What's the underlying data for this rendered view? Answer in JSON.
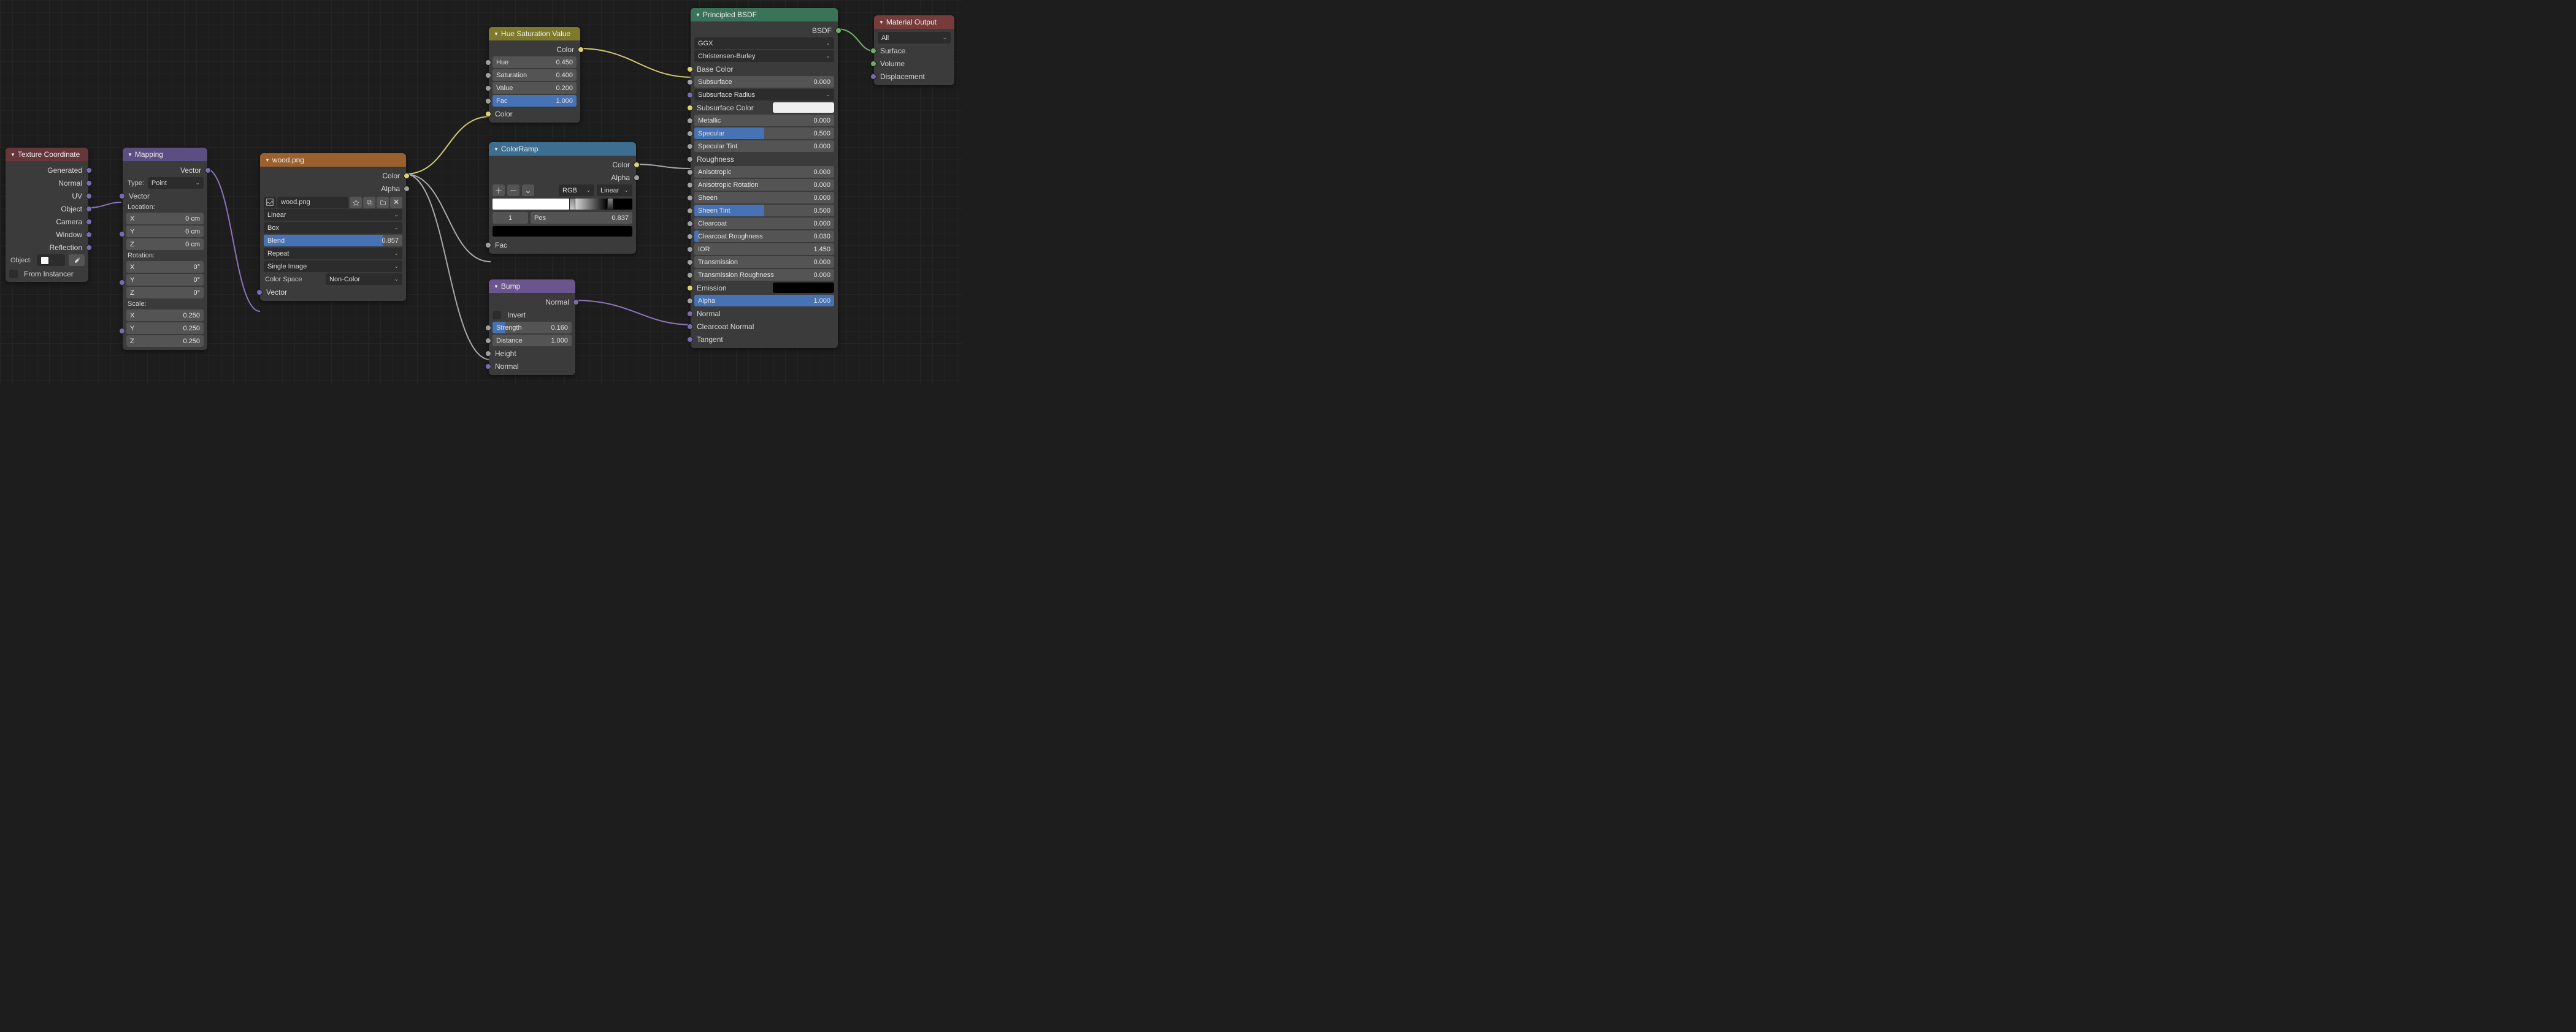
{
  "nodes": {
    "texcoord": {
      "title": "Texture Coordinate",
      "outputs": [
        "Generated",
        "Normal",
        "UV",
        "Object",
        "Camera",
        "Window",
        "Reflection"
      ],
      "object_label": "Object:",
      "from_instancer": "From Instancer"
    },
    "mapping": {
      "title": "Mapping",
      "out_vector": "Vector",
      "type_label": "Type:",
      "type_value": "Point",
      "in_vector": "Vector",
      "location_label": "Location:",
      "loc_x": {
        "k": "X",
        "v": "0 cm"
      },
      "loc_y": {
        "k": "Y",
        "v": "0 cm"
      },
      "loc_z": {
        "k": "Z",
        "v": "0 cm"
      },
      "rotation_label": "Rotation:",
      "rot_x": {
        "k": "X",
        "v": "0°"
      },
      "rot_y": {
        "k": "Y",
        "v": "0°"
      },
      "rot_z": {
        "k": "Z",
        "v": "0°"
      },
      "scale_label": "Scale:",
      "scl_x": {
        "k": "X",
        "v": "0.250"
      },
      "scl_y": {
        "k": "Y",
        "v": "0.250"
      },
      "scl_z": {
        "k": "Z",
        "v": "0.250"
      }
    },
    "image": {
      "title": "wood.png",
      "out_color": "Color",
      "out_alpha": "Alpha",
      "filename": "wood.png",
      "interp": "Linear",
      "proj": "Box",
      "blend": {
        "k": "Blend",
        "v": "0.857"
      },
      "ext": "Repeat",
      "source": "Single Image",
      "colorspace_label": "Color Space",
      "colorspace": "Non-Color",
      "in_vector": "Vector"
    },
    "hsv": {
      "title": "Hue Saturation Value",
      "out_color": "Color",
      "hue": {
        "k": "Hue",
        "v": "0.450"
      },
      "sat": {
        "k": "Saturation",
        "v": "0.400"
      },
      "val": {
        "k": "Value",
        "v": "0.200"
      },
      "fac": {
        "k": "Fac",
        "v": "1.000"
      },
      "in_color": "Color"
    },
    "ramp": {
      "title": "ColorRamp",
      "out_color": "Color",
      "out_alpha": "Alpha",
      "mode": "RGB",
      "interp": "Linear",
      "index": "1",
      "pos": {
        "k": "Pos",
        "v": "0.837"
      },
      "in_fac": "Fac"
    },
    "bump": {
      "title": "Bump",
      "out_normal": "Normal",
      "invert": "Invert",
      "strength": {
        "k": "Strength",
        "v": "0.160"
      },
      "distance": {
        "k": "Distance",
        "v": "1.000"
      },
      "in_height": "Height",
      "in_normal": "Normal"
    },
    "bsdf": {
      "title": "Principled BSDF",
      "out_bsdf": "BSDF",
      "dist": "GGX",
      "sss_method": "Christensen-Burley",
      "base_color": "Base Color",
      "subsurface": {
        "k": "Subsurface",
        "v": "0.000"
      },
      "sss_radius": "Subsurface Radius",
      "sss_color": "Subsurface Color",
      "metallic": {
        "k": "Metallic",
        "v": "0.000"
      },
      "specular": {
        "k": "Specular",
        "v": "0.500"
      },
      "spec_tint": {
        "k": "Specular Tint",
        "v": "0.000"
      },
      "roughness": "Roughness",
      "aniso": {
        "k": "Anisotropic",
        "v": "0.000"
      },
      "aniso_rot": {
        "k": "Anisotropic Rotation",
        "v": "0.000"
      },
      "sheen": {
        "k": "Sheen",
        "v": "0.000"
      },
      "sheen_tint": {
        "k": "Sheen Tint",
        "v": "0.500"
      },
      "clearcoat": {
        "k": "Clearcoat",
        "v": "0.000"
      },
      "cc_rough": {
        "k": "Clearcoat Roughness",
        "v": "0.030"
      },
      "ior": {
        "k": "IOR",
        "v": "1.450"
      },
      "transmission": {
        "k": "Transmission",
        "v": "0.000"
      },
      "trans_rough": {
        "k": "Transmission Roughness",
        "v": "0.000"
      },
      "emission": "Emission",
      "alpha": {
        "k": "Alpha",
        "v": "1.000"
      },
      "normal": "Normal",
      "cc_normal": "Clearcoat Normal",
      "tangent": "Tangent"
    },
    "output": {
      "title": "Material Output",
      "target": "All",
      "surface": "Surface",
      "volume": "Volume",
      "displacement": "Displacement"
    }
  }
}
